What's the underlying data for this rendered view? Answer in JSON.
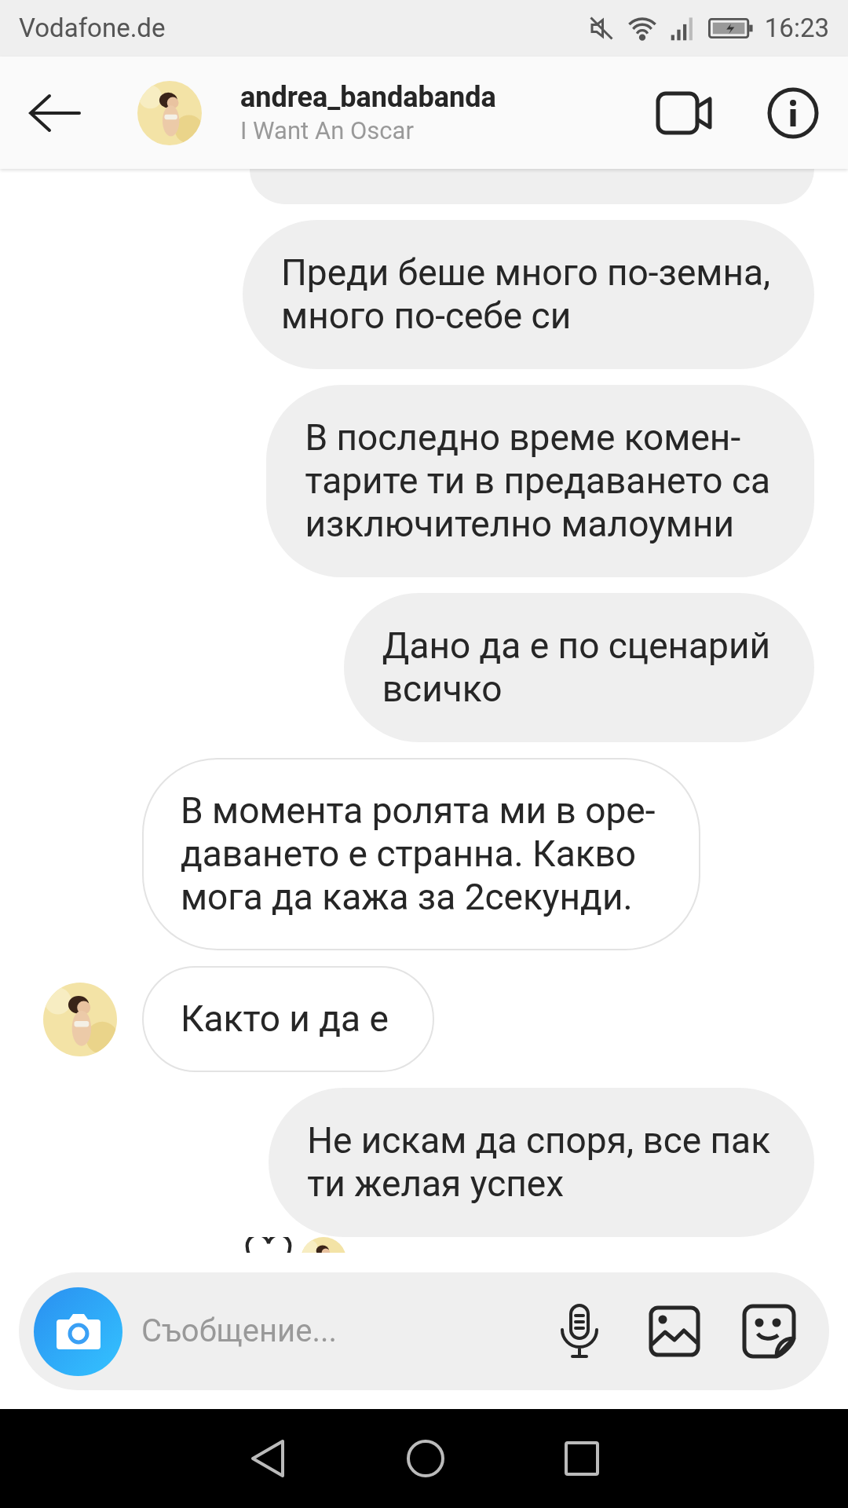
{
  "status_bar": {
    "carrier": "Vodafone.de",
    "time": "16:23"
  },
  "header": {
    "username": "andrea_bandabanda",
    "subtitle": "I Want An Oscar"
  },
  "messages": [
    {
      "kind": "sent",
      "partial": true
    },
    {
      "kind": "sent",
      "text": "Преди беше много по-земна,\nмного по-себе си"
    },
    {
      "kind": "sent",
      "text": "В последно време комен-\nтарите ти в предаването са\nизключително малоумни"
    },
    {
      "kind": "sent",
      "text": "Дано да е по сценарий\nвсичко"
    },
    {
      "kind": "received",
      "text": "В момента ролята ми в оре-\nдаването е странна. Какво\nмога да кажа за 2секунди.",
      "avatar": false
    },
    {
      "kind": "received",
      "text": "Както и да е",
      "avatar": true
    },
    {
      "kind": "sent",
      "text": "Не искам да споря, все пак\nти желая успех",
      "reacted": true
    }
  ],
  "composer": {
    "placeholder": "Съобщение..."
  }
}
